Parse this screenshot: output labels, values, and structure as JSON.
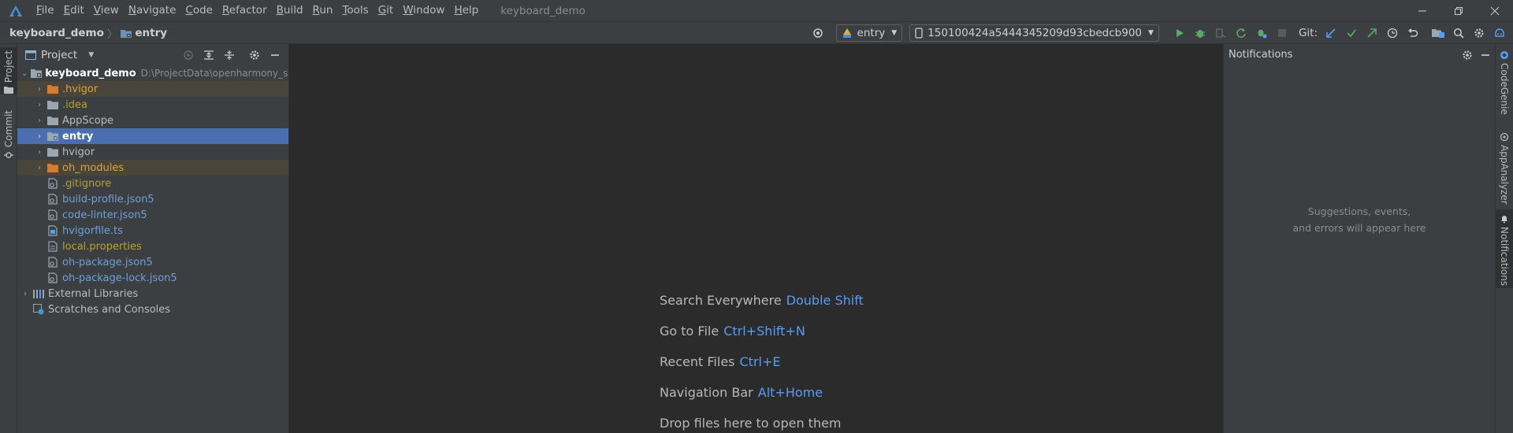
{
  "menu": {
    "items": [
      {
        "mnemonic": "F",
        "rest": "ile"
      },
      {
        "mnemonic": "E",
        "rest": "dit"
      },
      {
        "mnemonic": "V",
        "rest": "iew"
      },
      {
        "mnemonic": "N",
        "rest": "avigate"
      },
      {
        "mnemonic": "C",
        "rest": "ode"
      },
      {
        "mnemonic": "R",
        "rest": "efactor"
      },
      {
        "mnemonic": "B",
        "rest": "uild"
      },
      {
        "mnemonic": "R",
        "rest": "un"
      },
      {
        "mnemonic": "T",
        "rest": "ools"
      },
      {
        "mnemonic": "G",
        "rest": "it"
      },
      {
        "mnemonic": "W",
        "rest": "indow"
      },
      {
        "mnemonic": "H",
        "rest": "elp"
      }
    ],
    "window_title": "keyboard_demo"
  },
  "breadcrumb": {
    "project": "keyboard_demo",
    "module": "entry"
  },
  "toolbar": {
    "run_config": "entry",
    "device": "150100424a5444345209d93cbedcb900",
    "git_label": "Git:"
  },
  "left_stripe": {
    "project_tab": "Project",
    "commit_tab": "Commit"
  },
  "project_panel": {
    "title": "Project",
    "root": {
      "name": "keyboard_demo",
      "path": "D:\\ProjectData\\openharmony_six_e"
    },
    "items": [
      {
        "name": ".hvigor",
        "kind": "folder-excluded"
      },
      {
        "name": ".idea",
        "kind": "folder"
      },
      {
        "name": "AppScope",
        "kind": "folder"
      },
      {
        "name": "entry",
        "kind": "module-selected"
      },
      {
        "name": "hvigor",
        "kind": "folder"
      },
      {
        "name": "oh_modules",
        "kind": "folder-excluded"
      },
      {
        "name": ".gitignore",
        "kind": "file"
      },
      {
        "name": "build-profile.json5",
        "kind": "file"
      },
      {
        "name": "code-linter.json5",
        "kind": "file"
      },
      {
        "name": "hvigorfile.ts",
        "kind": "file"
      },
      {
        "name": "local.properties",
        "kind": "file"
      },
      {
        "name": "oh-package.json5",
        "kind": "file"
      },
      {
        "name": "oh-package-lock.json5",
        "kind": "file"
      }
    ],
    "external_libraries": "External Libraries",
    "scratches": "Scratches and Consoles"
  },
  "editor_hints": [
    {
      "action": "Search Everywhere",
      "shortcut": "Double Shift"
    },
    {
      "action": "Go to File",
      "shortcut": "Ctrl+Shift+N"
    },
    {
      "action": "Recent Files",
      "shortcut": "Ctrl+E"
    },
    {
      "action": "Navigation Bar",
      "shortcut": "Alt+Home"
    },
    {
      "action": "Drop files here to open them",
      "shortcut": ""
    }
  ],
  "notifications": {
    "title": "Notifications",
    "empty_line1": "Suggestions, events,",
    "empty_line2": "and errors will appear here"
  },
  "right_stripe": {
    "tab1": "CodeGenie",
    "tab2": "AppAnalyzer",
    "tab3": "Notifications"
  },
  "colors": {
    "accent": "#589df6",
    "selection": "#4b6eaf",
    "excluded_bg": "#49453b",
    "run_green": "#59a869"
  }
}
